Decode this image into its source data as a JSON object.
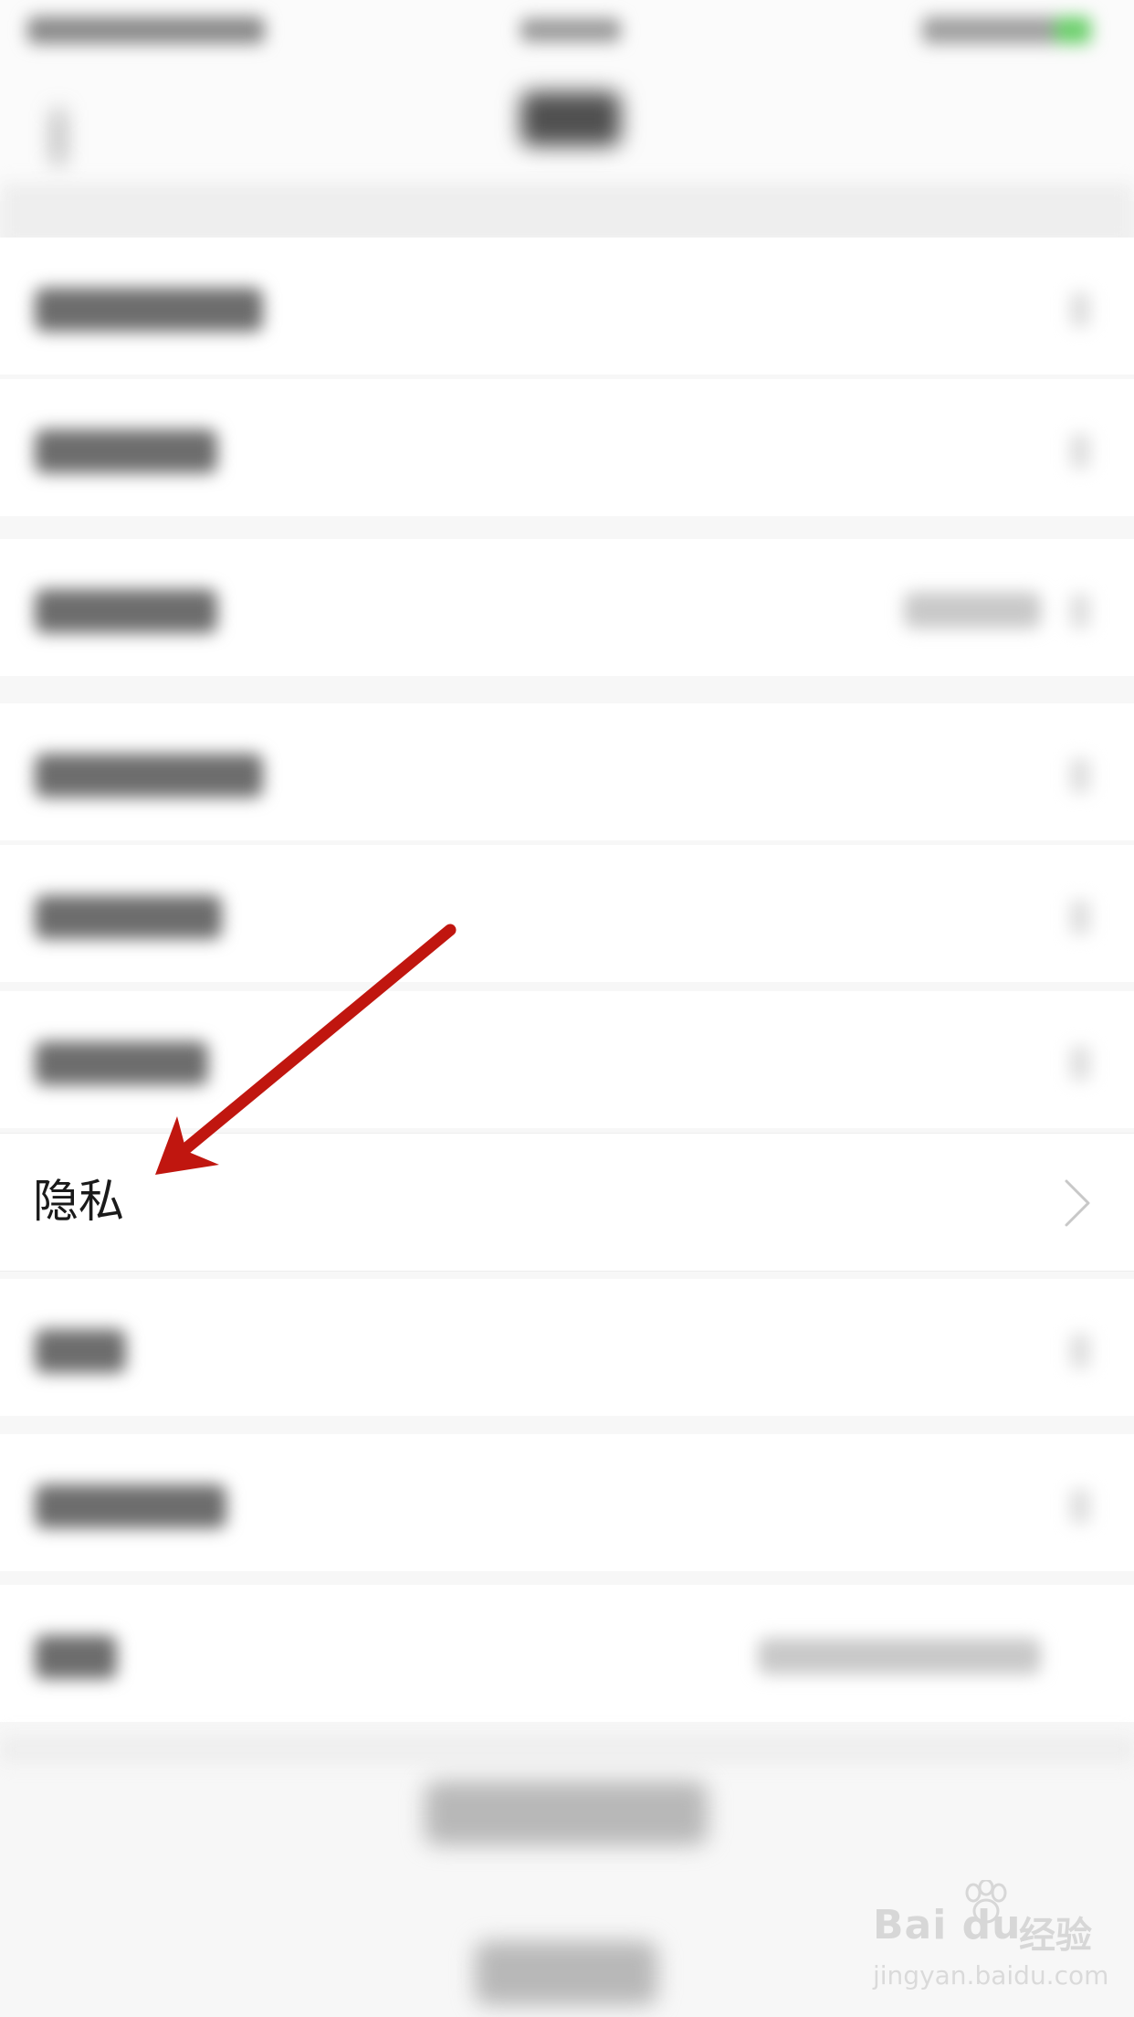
{
  "privacy_item": {
    "label": "隐私"
  },
  "watermark": {
    "brand": "Bai du",
    "brand_cn": "经验",
    "url": "jingyan.baidu.com"
  },
  "colors": {
    "arrow": "#c0160f",
    "chevron": "#c8c8c8",
    "label": "#1a1a1a"
  },
  "icons": {
    "privacy_chevron": "chevron-right-icon",
    "annotation": "red-arrow-annotation",
    "watermark_logo": "baidu-paw-logo"
  }
}
